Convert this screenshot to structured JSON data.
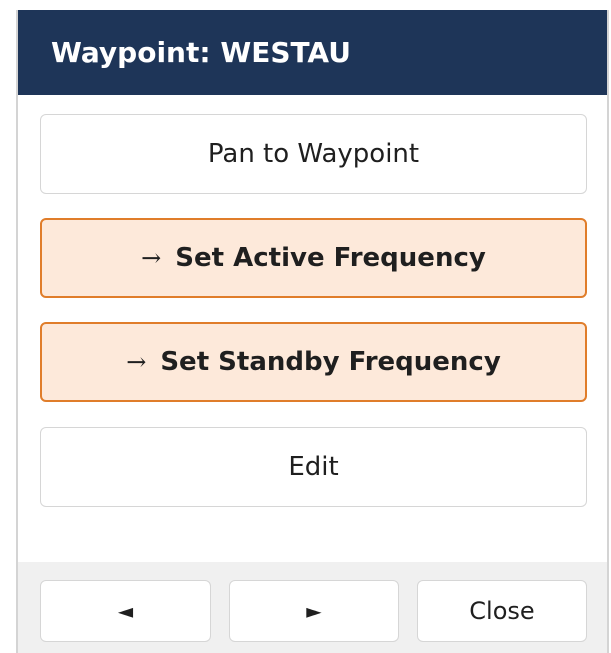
{
  "dialog": {
    "title": "Waypoint: WESTAU"
  },
  "actions": {
    "pan_label": "Pan to Waypoint",
    "set_active_label": "Set Active Frequency",
    "set_standby_label": "Set Standby Frequency",
    "edit_label": "Edit",
    "arrow_glyph": "→"
  },
  "footer": {
    "prev_glyph": "◄",
    "next_glyph": "►",
    "close_label": "Close"
  },
  "colors": {
    "header_bg": "#1e3558",
    "accent_border": "#e07d2a",
    "accent_fill": "#fde9da"
  }
}
